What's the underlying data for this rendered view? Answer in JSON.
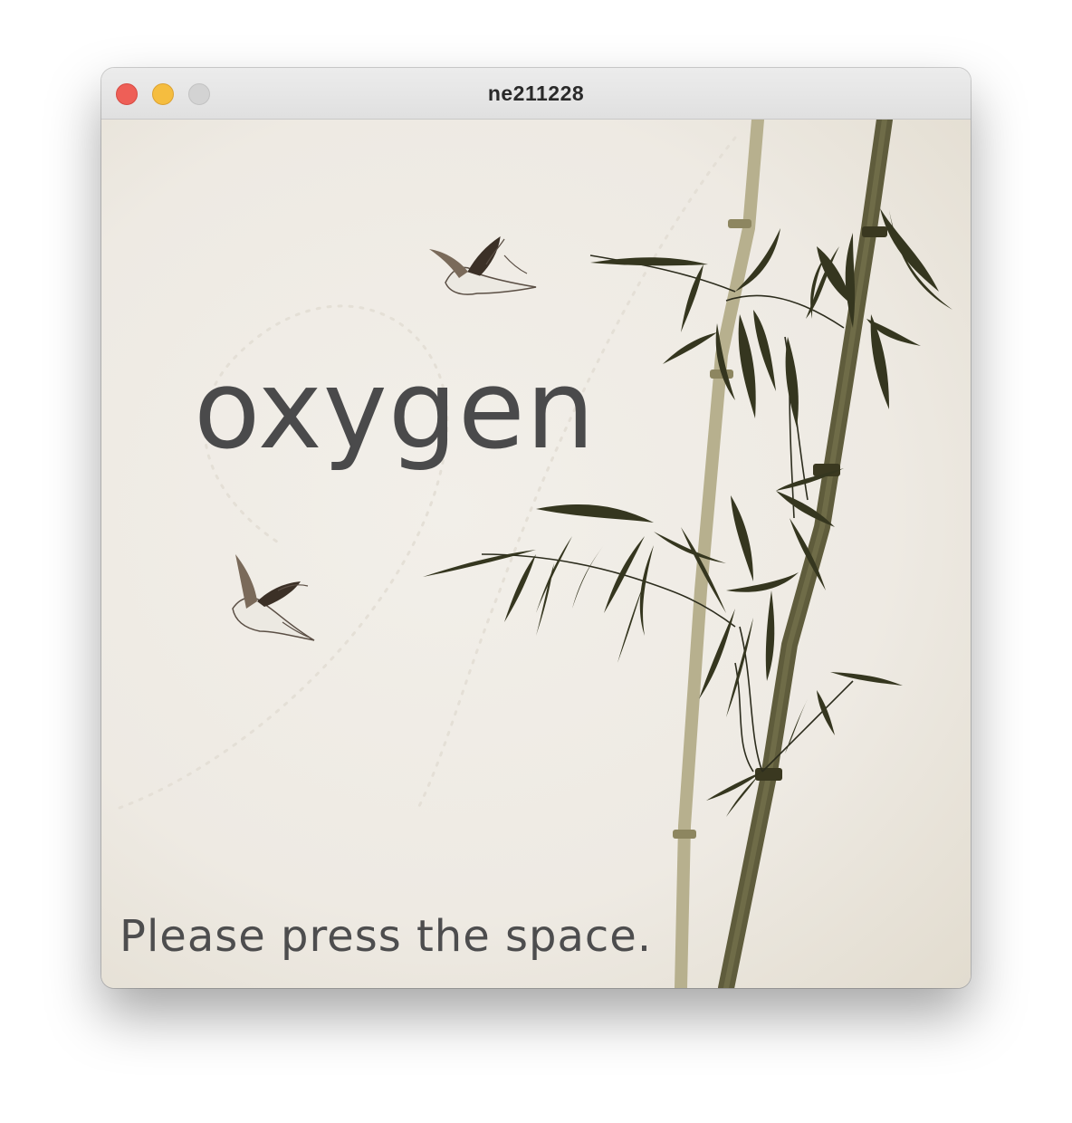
{
  "window": {
    "title": "ne211228"
  },
  "game": {
    "word": "oxygen",
    "prompt": "Please press the space."
  },
  "icons": {
    "close": "close-button",
    "minimize": "minimize-button",
    "zoom": "zoom-button"
  },
  "colors": {
    "background": "#efebe4",
    "text": "#4a4a4b",
    "bamboo": "#3f3f28",
    "close": "#ee5f57",
    "minimize": "#f5bd3f",
    "zoom": "#d3d3d3"
  }
}
